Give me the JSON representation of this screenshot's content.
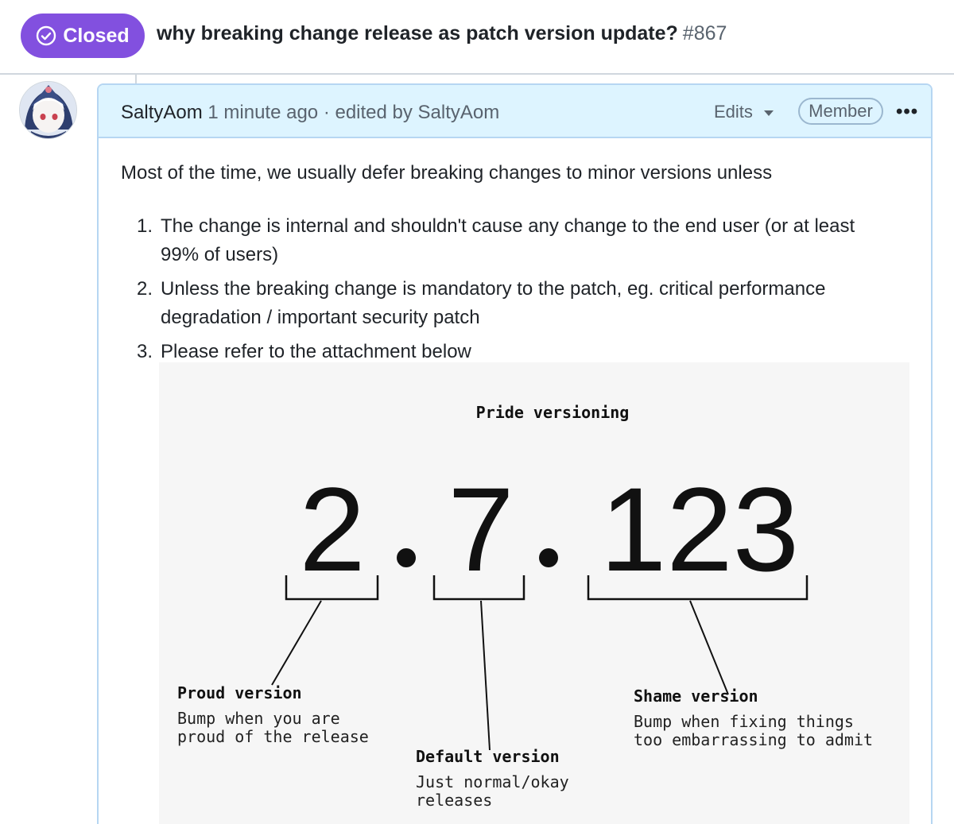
{
  "issue": {
    "status": "Closed",
    "title": "why breaking change release as patch version update?",
    "number": "#867",
    "status_color": "#8250df"
  },
  "comment": {
    "author": "SaltyAom",
    "time": "1 minute ago",
    "edited_text": "· edited by SaltyAom",
    "edits_label": "Edits",
    "role_badge": "Member",
    "menu_icon": "kebab-horizontal-icon",
    "intro": "Most of the time, we usually defer breaking changes to minor versions unless",
    "list": [
      {
        "n": "1.",
        "lines": [
          "The change is internal and shouldn't cause any change to the end user (or at least",
          "99% of users)"
        ]
      },
      {
        "n": "2.",
        "lines": [
          "Unless the breaking change is mandatory to the patch, eg. critical performance",
          "degradation / important security patch"
        ]
      },
      {
        "n": "3.",
        "lines": [
          "Please refer to the attachment below"
        ]
      }
    ]
  },
  "attachment": {
    "heading": "Pride versioning",
    "version": {
      "major": "2",
      "minor": "7",
      "patch": "123"
    },
    "proud": {
      "title": "Proud version",
      "line1": "Bump when you are",
      "line2": "proud of the release"
    },
    "default": {
      "title": "Default version",
      "line1": "Just normal/okay",
      "line2": "releases"
    },
    "shame": {
      "title": "Shame version",
      "line1": "Bump when fixing things",
      "line2": "too embarrassing to admit"
    }
  }
}
